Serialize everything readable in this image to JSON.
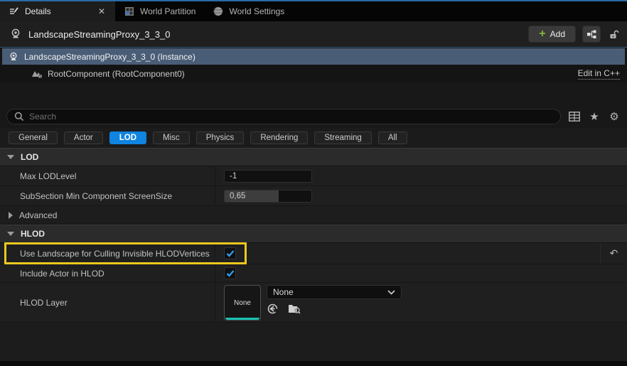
{
  "colors": {
    "accent_blue": "#0f84e0",
    "checkbox_blue": "#2f9ce8",
    "highlight_yellow": "#edc71f",
    "thumbnail_teal": "#17c2b2",
    "add_green": "#7fba3c",
    "selection_blue": "#4a5d77"
  },
  "tab_bar": {
    "tabs": [
      {
        "label": "Details",
        "active": true
      },
      {
        "label": "World Partition",
        "active": false
      },
      {
        "label": "World Settings",
        "active": false
      }
    ]
  },
  "header": {
    "title": "LandscapeStreamingProxy_3_3_0",
    "add_button": "Add"
  },
  "outliner": {
    "instance_label": "LandscapeStreamingProxy_3_3_0 (Instance)",
    "component_label": "RootComponent (RootComponent0)",
    "edit_cpp_link": "Edit in C++"
  },
  "search": {
    "placeholder": "Search"
  },
  "filter_tabs": {
    "items": [
      "General",
      "Actor",
      "LOD",
      "Misc",
      "Physics",
      "Rendering",
      "Streaming",
      "All"
    ],
    "active": "LOD"
  },
  "lod_section": {
    "title": "LOD",
    "max_lod_level": {
      "label": "Max LODLevel",
      "value": "-1"
    },
    "subsection_min": {
      "label": "SubSection Min Component ScreenSize",
      "value": "0,65",
      "fill_pct": 62
    },
    "advanced_label": "Advanced"
  },
  "hlod_section": {
    "title": "HLOD",
    "use_landscape": {
      "label": "Use Landscape for Culling Invisible HLODVertices",
      "checked": true,
      "highlighted": true
    },
    "include_actor": {
      "label": "Include Actor in HLOD",
      "checked": true
    },
    "hlod_layer": {
      "label": "HLOD Layer",
      "thumbnail_label": "None",
      "dropdown_value": "None"
    }
  }
}
